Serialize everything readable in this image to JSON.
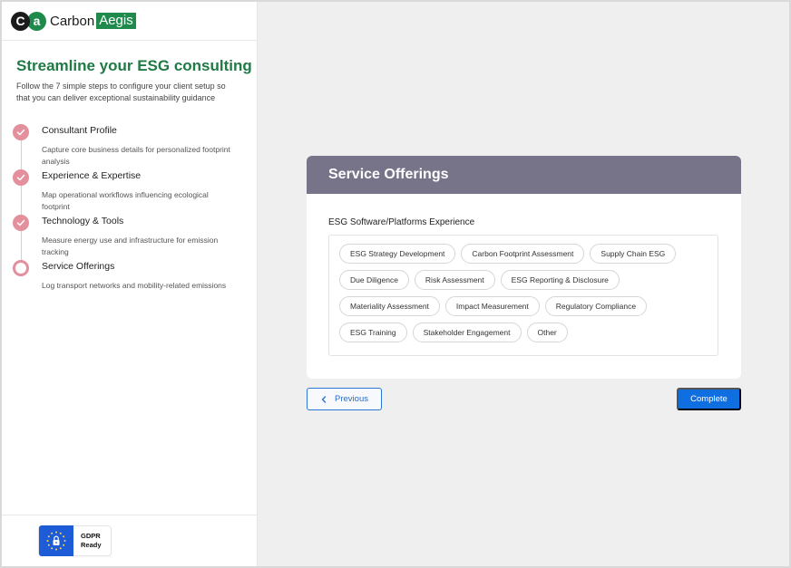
{
  "brand": {
    "mark_c": "C",
    "mark_a": "a",
    "name_part1": "Carbon",
    "name_part2": "Aegis",
    "color": "#1f8a4c"
  },
  "intro": {
    "headline": "Streamline your ESG consulting",
    "subtext": "Follow the 7 simple steps to configure your client setup so that you can deliver exceptional sustainability guidance"
  },
  "steps": [
    {
      "title": "Consultant Profile",
      "description": "Capture core business details for personalized footprint analysis",
      "status": "completed"
    },
    {
      "title": "Experience & Expertise",
      "description": "Map operational workflows influencing ecological footprint",
      "status": "completed"
    },
    {
      "title": "Technology & Tools",
      "description": "Measure energy use and infrastructure for emission tracking",
      "status": "completed"
    },
    {
      "title": "Service Offerings",
      "description": "Log transport networks and mobility-related emissions",
      "status": "current"
    }
  ],
  "footer": {
    "badge_line1": "GDPR",
    "badge_line2": "Ready",
    "badge_icon": "lock-icon"
  },
  "card": {
    "title": "Service Offerings",
    "field_label": "ESG Software/Platforms Experience",
    "header_color": "#777389",
    "options": [
      "ESG Strategy Development",
      "Carbon Footprint Assessment",
      "Supply Chain ESG",
      "Due Diligence",
      "Risk Assessment",
      "ESG Reporting & Disclosure",
      "Materiality Assessment",
      "Impact Measurement",
      "Regulatory Compliance",
      "ESG Training",
      "Stakeholder Engagement",
      "Other"
    ]
  },
  "actions": {
    "previous_label": "Previous",
    "complete_label": "Complete",
    "primary_color": "#0f6fe0"
  },
  "colors": {
    "step_accent": "#e3909c",
    "main_bg": "#efefef"
  }
}
